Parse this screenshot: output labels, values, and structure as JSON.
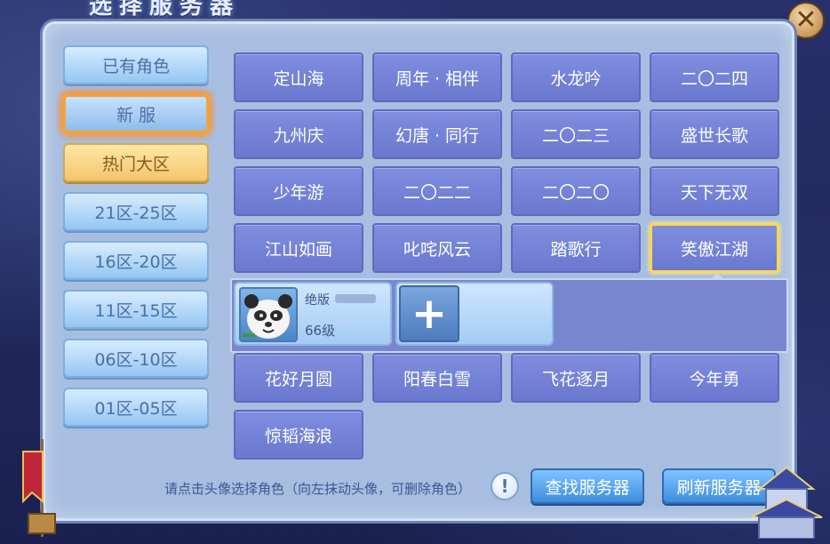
{
  "window": {
    "title": "选择服务器",
    "close_icon": "close-icon"
  },
  "sidebar": {
    "items": [
      {
        "label": "已有角色",
        "state": "normal"
      },
      {
        "label": "新 服",
        "state": "active"
      },
      {
        "label": "热门大区",
        "state": "hot"
      },
      {
        "label": "21区-25区",
        "state": "normal"
      },
      {
        "label": "16区-20区",
        "state": "normal"
      },
      {
        "label": "11区-15区",
        "state": "normal"
      },
      {
        "label": "06区-10区",
        "state": "normal"
      },
      {
        "label": "01区-05区",
        "state": "normal"
      }
    ]
  },
  "servers": {
    "rows": [
      [
        "定山海",
        "周年 · 相伴",
        "水龙吟",
        "二〇二四"
      ],
      [
        "九州庆",
        "幻唐 · 同行",
        "二〇二三",
        "盛世长歌"
      ],
      [
        "少年游",
        "二〇二二",
        "二〇二〇",
        "天下无双"
      ],
      [
        "江山如画",
        "叱咤风云",
        "踏歌行",
        "笑傲江湖"
      ],
      [
        "花好月圆",
        "阳春白雪",
        "飞花逐月",
        "今年勇"
      ],
      [
        "惊韬海浪"
      ]
    ],
    "selected": "笑傲江湖"
  },
  "character": {
    "name": "绝版",
    "level": "66级",
    "add_label": "+"
  },
  "footer": {
    "hint": "请点击头像选择角色（向左抹动头像，可删除角色）",
    "info_icon": "!",
    "find_button": "查找服务器",
    "refresh_button": "刷新服务器"
  },
  "colors": {
    "server_button": "#7483d6",
    "selected_border": "#ffd84a",
    "active_glow": "#ff8a20",
    "action_button": "#4b9ae8"
  }
}
